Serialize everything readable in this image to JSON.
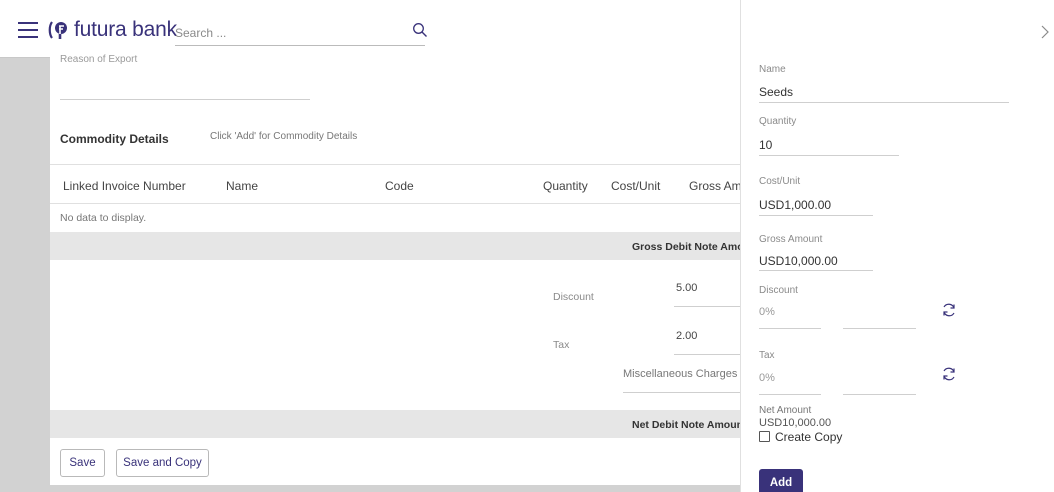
{
  "header": {
    "brand": "futura bank",
    "search": {
      "placeholder": "Search ...",
      "value": ""
    }
  },
  "main": {
    "reason_label": "Reason of Export",
    "commodity_title": "Commodity Details",
    "commodity_hint": "Click 'Add' for Commodity Details",
    "columns": [
      "Linked Invoice Number",
      "Name",
      "Code",
      "Quantity",
      "Cost/Unit",
      "Gross Amo"
    ],
    "empty_text": "No data to display.",
    "gross_band": "Gross Debit Note Amou",
    "discount_label": "Discount",
    "discount_value": "5.00",
    "tax_label": "Tax",
    "tax_value": "2.00",
    "misc_label": "Miscellaneous Charges",
    "net_band": "Net Debit Note Amoun",
    "save_label": "Save",
    "save_copy_label": "Save and Copy"
  },
  "drawer": {
    "name_label": "Name",
    "name_value": "Seeds",
    "quantity_label": "Quantity",
    "quantity_value": "10",
    "cost_label": "Cost/Unit",
    "cost_value": "USD1,000.00",
    "gross_label": "Gross Amount",
    "gross_value": "USD10,000.00",
    "discount_label": "Discount",
    "discount_value": "0%",
    "tax_label": "Tax",
    "tax_value": "0%",
    "net_label": "Net Amount",
    "net_value": "USD10,000.00",
    "create_copy_label": "Create Copy",
    "create_copy_checked": false,
    "add_label": "Add"
  },
  "colors": {
    "brand": "#39327a",
    "backdrop": "#d2d2d2",
    "band": "#e6e6e6"
  }
}
